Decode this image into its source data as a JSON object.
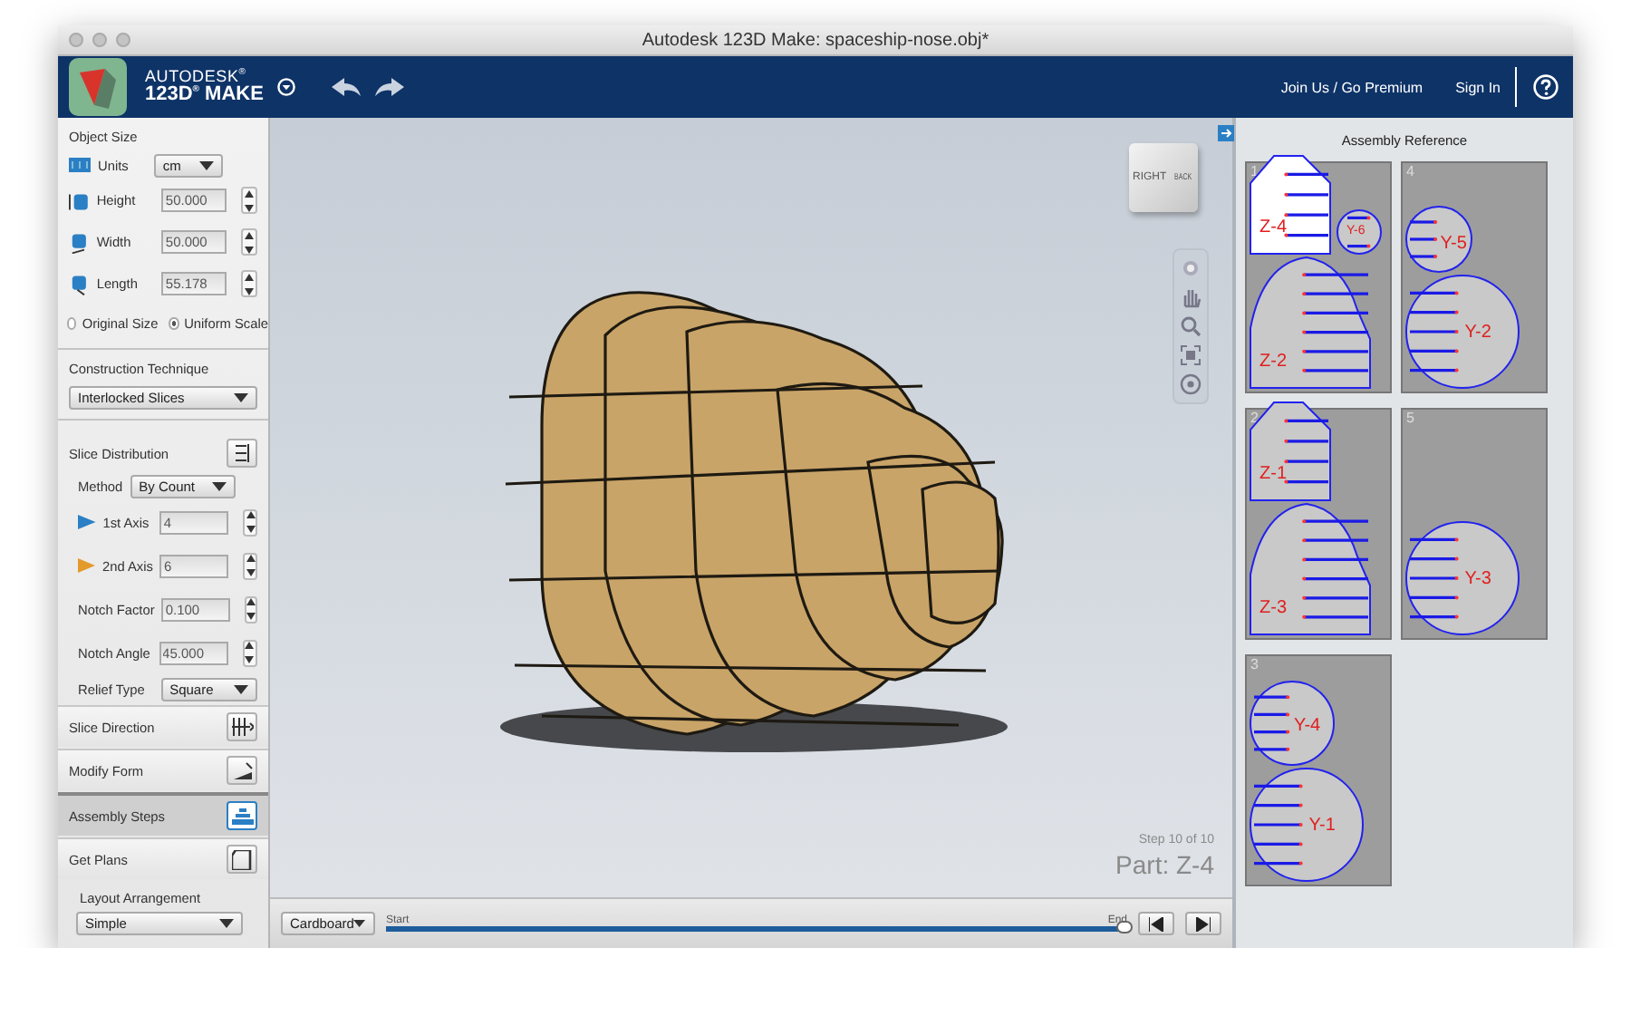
{
  "window": {
    "title": "Autodesk 123D Make: spaceship-nose.obj*"
  },
  "header": {
    "brand": "AUTODESK$^{®}$",
    "product": "123D$^{®}$ MAKE",
    "links": [
      {
        "label": "Join Us / Go Premium"
      },
      {
        "label": "Sign In"
      }
    ]
  },
  "object_size": {
    "title": "Object Size",
    "units": {
      "label": "Units",
      "value": "cm"
    },
    "fields": [
      {
        "label": "Height",
        "value": "50.000",
        "kind": "height"
      },
      {
        "label": "Width",
        "value": "50.000",
        "kind": "width"
      },
      {
        "label": "Length",
        "value": "55.178",
        "kind": "length"
      }
    ],
    "scale_options": [
      {
        "label": "Original Size",
        "selected": false
      },
      {
        "label": "Uniform Scale",
        "selected": true
      }
    ]
  },
  "construction": {
    "title": "Construction Technique",
    "value": "Interlocked Slices"
  },
  "slice_distribution": {
    "title": "Slice Distribution",
    "method": {
      "label": "Method",
      "value": "By Count"
    },
    "fields": [
      {
        "label": "1st Axis",
        "value": "4",
        "kind": "axis-blue"
      },
      {
        "label": "2nd Axis",
        "value": "6",
        "kind": "axis-orange"
      },
      {
        "label": "Notch Factor",
        "value": "0.100",
        "kind": "plain"
      },
      {
        "label": "Notch Angle",
        "value": "45.000",
        "kind": "plain"
      }
    ],
    "relief": {
      "label": "Relief Type",
      "value": "Square"
    }
  },
  "sections": [
    {
      "title": "Slice Direction",
      "kind": "direction",
      "selected": false
    },
    {
      "title": "Modify Form",
      "kind": "form",
      "selected": false
    },
    {
      "title": "Assembly Steps",
      "kind": "steps",
      "selected": true
    },
    {
      "title": "Get Plans",
      "kind": "plans",
      "selected": false
    }
  ],
  "get_plans": {
    "label": "Layout Arrangement",
    "value": "Simple"
  },
  "viewport": {
    "cube_faces": [
      "RIGHT",
      "BACK"
    ],
    "step": "Step 10 of 10",
    "part": "Part: Z-4",
    "material": "Cardboard",
    "timeline": {
      "start": "Start",
      "end": "End",
      "level": 1.0
    }
  },
  "assembly_reference": {
    "title": "Assembly Reference",
    "steps": [
      {
        "number": "1",
        "parts": [
          {
            "label": "Z-4",
            "kind": "dome",
            "selected": true
          },
          {
            "label": "Y-6",
            "kind": "small-circle",
            "selected": false
          },
          {
            "label": "Z-2",
            "kind": "tall-dome",
            "selected": false
          }
        ]
      },
      {
        "number": "4",
        "parts": [
          {
            "label": "Y-5",
            "kind": "medium-circle",
            "selected": false
          },
          {
            "label": "Y-2",
            "kind": "large-circle",
            "selected": false
          }
        ]
      },
      {
        "number": "2",
        "parts": [
          {
            "label": "Z-1",
            "kind": "dome",
            "selected": false
          },
          {
            "label": "Z-3",
            "kind": "tall-dome",
            "selected": false
          }
        ]
      },
      {
        "number": "5",
        "parts": [
          {
            "label": "Y-3",
            "kind": "large-circle",
            "selected": false
          }
        ]
      },
      {
        "number": "3",
        "parts": [
          {
            "label": "Y-4",
            "kind": "half-circle",
            "selected": false
          },
          {
            "label": "Y-1",
            "kind": "large-circle",
            "selected": false
          }
        ]
      }
    ]
  }
}
